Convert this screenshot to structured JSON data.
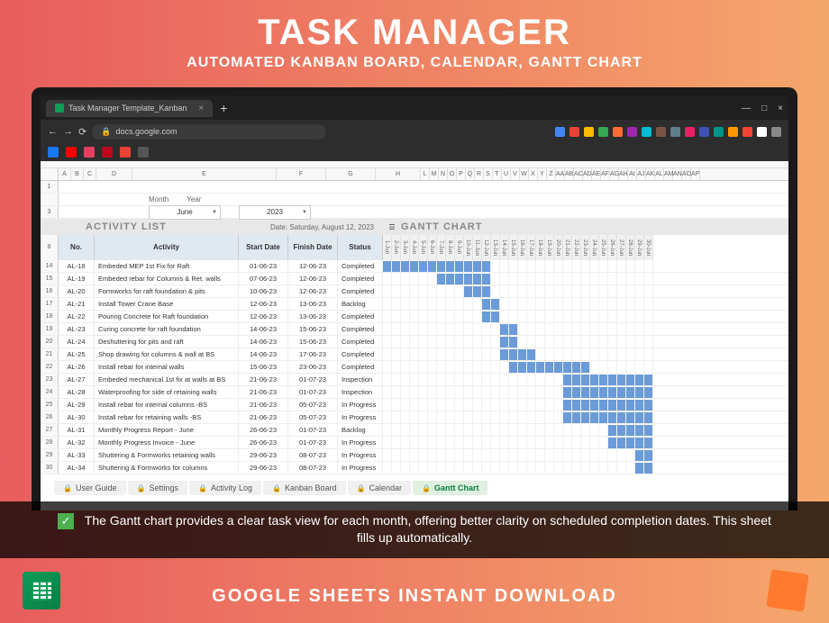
{
  "header": {
    "title": "TASK MANAGER",
    "subtitle": "AUTOMATED KANBAN BOARD, CALENDAR, GANTT CHART"
  },
  "browser": {
    "tab_title": "Task Manager Template_Kanban",
    "url": "docs.google.com"
  },
  "selectors": {
    "month_label": "Month",
    "month": "June",
    "year_label": "Year",
    "year": "2023"
  },
  "activity": {
    "title": "ACTIVITY LIST",
    "date_label": "Date:",
    "date": "Saturday, August 12, 2023",
    "cols": [
      "No.",
      "Activity",
      "Start Date",
      "Finish Date",
      "Status"
    ]
  },
  "gantt": {
    "title": "GANTT CHART",
    "days": [
      "1-Jun",
      "2-Jun",
      "3-Jun",
      "4-Jun",
      "5-Jun",
      "6-Jun",
      "7-Jun",
      "8-Jun",
      "9-Jun",
      "10-Jun",
      "11-Jun",
      "12-Jun",
      "13-Jun",
      "14-Jun",
      "15-Jun",
      "16-Jun",
      "17-Jun",
      "18-Jun",
      "19-Jun",
      "20-Jun",
      "21-Jun",
      "22-Jun",
      "23-Jun",
      "24-Jun",
      "25-Jun",
      "26-Jun",
      "27-Jun",
      "28-Jun",
      "29-Jun",
      "30-Jun"
    ]
  },
  "rows": [
    {
      "n": "14",
      "no": "AL-18",
      "act": "Embeded MEP 1st Fix for Raft",
      "sd": "01-06-23",
      "fd": "12-06-23",
      "st": "Completed",
      "gs": 1,
      "ge": 12
    },
    {
      "n": "15",
      "no": "AL-19",
      "act": "Embeded rebar for Columns & Ret. walls",
      "sd": "07-06-23",
      "fd": "12-06-23",
      "st": "Completed",
      "gs": 7,
      "ge": 12
    },
    {
      "n": "16",
      "no": "AL-20",
      "act": "Formworks for raft foundation & pits",
      "sd": "10-06-23",
      "fd": "12-06-23",
      "st": "Completed",
      "gs": 10,
      "ge": 12
    },
    {
      "n": "17",
      "no": "AL-21",
      "act": "Install Tower Crane Base",
      "sd": "12-06-23",
      "fd": "13-06-23",
      "st": "Backlog",
      "gs": 12,
      "ge": 13
    },
    {
      "n": "18",
      "no": "AL-22",
      "act": "Pouring Concrete for Raft foundation",
      "sd": "12-06-23",
      "fd": "13-06-23",
      "st": "Completed",
      "gs": 12,
      "ge": 13
    },
    {
      "n": "19",
      "no": "AL-23",
      "act": "Curing concrete for raft foundation",
      "sd": "14-06-23",
      "fd": "15-06-23",
      "st": "Completed",
      "gs": 14,
      "ge": 15
    },
    {
      "n": "20",
      "no": "AL-24",
      "act": "Deshuttering for pits and raft",
      "sd": "14-06-23",
      "fd": "15-06-23",
      "st": "Completed",
      "gs": 14,
      "ge": 15
    },
    {
      "n": "21",
      "no": "AL-25",
      "act": "Shop drawing for columns & wall at BS",
      "sd": "14-06-23",
      "fd": "17-06-23",
      "st": "Completed",
      "gs": 14,
      "ge": 17
    },
    {
      "n": "22",
      "no": "AL-26",
      "act": "Install rebar for internal walls",
      "sd": "15-06-23",
      "fd": "23-06-23",
      "st": "Completed",
      "gs": 15,
      "ge": 23
    },
    {
      "n": "23",
      "no": "AL-27",
      "act": "Embeded mechanical 1st fix at walls at BS",
      "sd": "21-06-23",
      "fd": "01-07-23",
      "st": "Inspection",
      "gs": 21,
      "ge": 30
    },
    {
      "n": "24",
      "no": "AL-28",
      "act": "Waterproofing for side of retaining walls",
      "sd": "21-06-23",
      "fd": "01-07-23",
      "st": "Inspection",
      "gs": 21,
      "ge": 30
    },
    {
      "n": "25",
      "no": "AL-29",
      "act": "Install rebar for internal columns -BS",
      "sd": "21-06-23",
      "fd": "05-07-23",
      "st": "In Progress",
      "gs": 21,
      "ge": 30
    },
    {
      "n": "26",
      "no": "AL-30",
      "act": "Install rebar for retaining walls -BS",
      "sd": "21-06-23",
      "fd": "05-07-23",
      "st": "In Progress",
      "gs": 21,
      "ge": 30
    },
    {
      "n": "27",
      "no": "AL-31",
      "act": "Monthly Progress Report - June",
      "sd": "26-06-23",
      "fd": "01-07-23",
      "st": "Backlog",
      "gs": 26,
      "ge": 30
    },
    {
      "n": "28",
      "no": "AL-32",
      "act": "Monthly Progress Invoice - June",
      "sd": "26-06-23",
      "fd": "01-07-23",
      "st": "In Progress",
      "gs": 26,
      "ge": 30
    },
    {
      "n": "29",
      "no": "AL-33",
      "act": "Shuttering & Formworks retaining walls",
      "sd": "29-06-23",
      "fd": "08-07-23",
      "st": "In Progress",
      "gs": 29,
      "ge": 30
    },
    {
      "n": "30",
      "no": "AL-34",
      "act": "Shuttering & Formworks for columns",
      "sd": "29-06-23",
      "fd": "08-07-23",
      "st": "In Progress",
      "gs": 29,
      "ge": 30
    }
  ],
  "col_letters": [
    "A",
    "B",
    "C",
    "D",
    "E",
    "F",
    "G",
    "H"
  ],
  "gantt_cols": [
    "L",
    "M",
    "N",
    "O",
    "P",
    "Q",
    "R",
    "S",
    "T",
    "U",
    "V",
    "W",
    "X",
    "Y",
    "Z",
    "AA",
    "AB",
    "AC",
    "AD",
    "AE",
    "AF",
    "AG",
    "AH",
    "AI",
    "AJ",
    "AK",
    "AL",
    "AM",
    "AN",
    "AO",
    "AP"
  ],
  "tabs": [
    "User Guide",
    "Settings",
    "Activity Log",
    "Kanban Board",
    "Calendar",
    "Gantt Chart"
  ],
  "caption": "The Gantt chart provides a clear task view for each month, offering better clarity on scheduled completion dates. This sheet fills up automatically.",
  "footer": "GOOGLE SHEETS INSTANT DOWNLOAD",
  "ext_colors": [
    "#4285f4",
    "#ea4335",
    "#fbbc05",
    "#34a853",
    "#ff6b35",
    "#9c27b0",
    "#00bcd4",
    "#795548",
    "#607d8b",
    "#e91e63",
    "#3f51b5",
    "#009688",
    "#ff9800",
    "#f44336",
    "#fff",
    "#888"
  ],
  "bm_colors": [
    "#1877f2",
    "#ff0000",
    "#e4405f",
    "#bd081c",
    "#ea4335",
    "#555"
  ]
}
